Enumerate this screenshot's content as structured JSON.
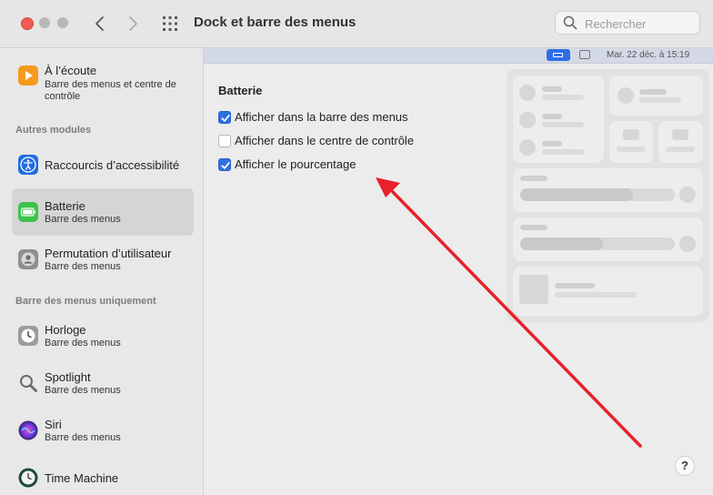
{
  "window": {
    "title": "Dock et barre des menus",
    "search_placeholder": "Rechercher"
  },
  "sidebar": {
    "top_item": {
      "title": "À l’écoute",
      "subtitle": "Barre des menus et centre de contrôle"
    },
    "section_other": "Autres modules",
    "section_menubar_only": "Barre des menus uniquement",
    "items": [
      {
        "title": "Raccourcis d’accessibilité",
        "subtitle": ""
      },
      {
        "title": "Batterie",
        "subtitle": "Barre des menus"
      },
      {
        "title": "Permutation d’utilisateur",
        "subtitle": "Barre des menus"
      },
      {
        "title": "Horloge",
        "subtitle": "Barre des menus"
      },
      {
        "title": "Spotlight",
        "subtitle": "Barre des menus"
      },
      {
        "title": "Siri",
        "subtitle": "Barre des menus"
      },
      {
        "title": "Time Machine",
        "subtitle": ""
      }
    ],
    "selected": "Batterie"
  },
  "menubar_preview": {
    "clock": "Mar. 22 déc. à  15:19"
  },
  "main": {
    "section_title": "Batterie",
    "options": [
      {
        "label": "Afficher dans la barre des menus",
        "checked": true
      },
      {
        "label": "Afficher dans le centre de contrôle",
        "checked": false
      },
      {
        "label": "Afficher le pourcentage",
        "checked": true
      }
    ],
    "help_label": "?"
  },
  "colors": {
    "accent": "#2f6fe0",
    "annotation_arrow": "#e8212a",
    "close_button": "#ee5b55"
  },
  "icons": {
    "back": "chevron-left-icon",
    "forward": "chevron-right-icon",
    "all_prefs": "grid-icon",
    "search": "magnifier-icon"
  }
}
